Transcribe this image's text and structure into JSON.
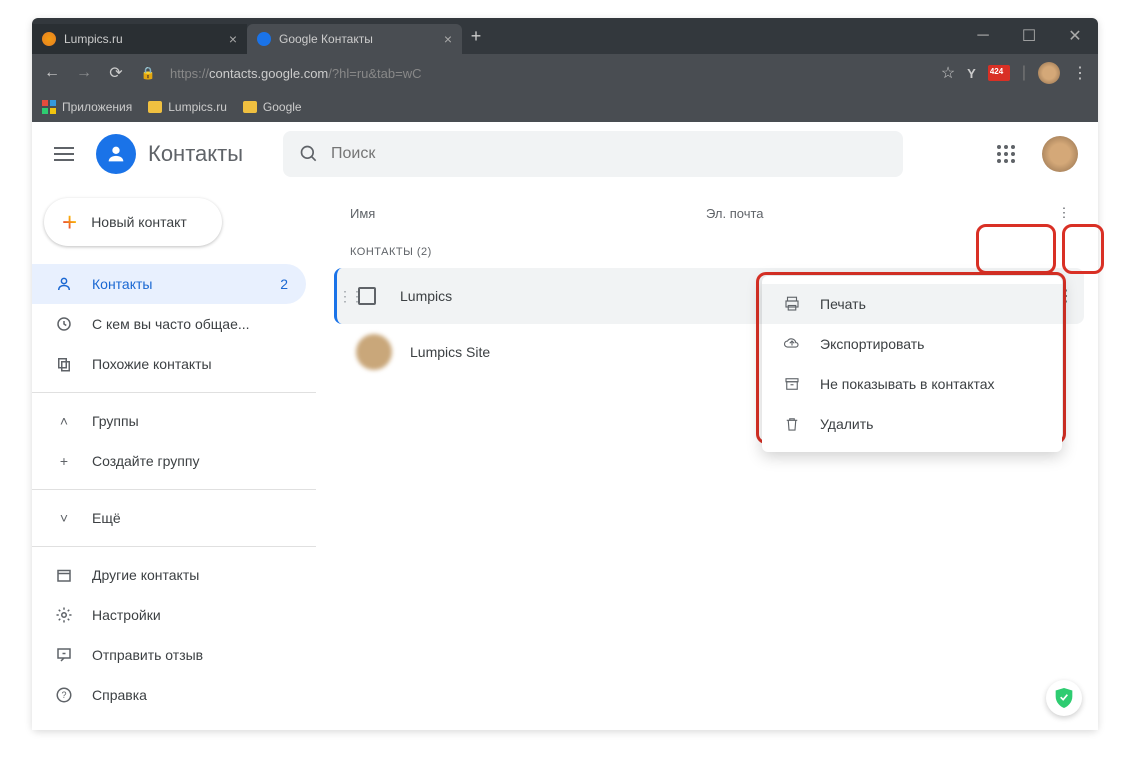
{
  "browser": {
    "tabs": [
      {
        "title": "Lumpics.ru",
        "active": false
      },
      {
        "title": "Google Контакты",
        "active": true
      }
    ],
    "url_prefix": "https://",
    "url_host": "contacts.google.com",
    "url_path": "/?hl=ru&tab=wC",
    "badge": "424",
    "bookmarks": {
      "apps": "Приложения",
      "b1": "Lumpics.ru",
      "b2": "Google"
    }
  },
  "header": {
    "title": "Контакты",
    "search_placeholder": "Поиск"
  },
  "sidebar": {
    "new_contact": "Новый контакт",
    "items": {
      "contacts": "Контакты",
      "contacts_count": "2",
      "frequent": "С кем вы часто общае...",
      "similar": "Похожие контакты",
      "groups": "Группы",
      "create_group": "Создайте группу",
      "more": "Ещё",
      "other": "Другие контакты",
      "settings": "Настройки",
      "feedback": "Отправить отзыв",
      "help": "Справка"
    }
  },
  "main": {
    "col_name": "Имя",
    "col_email": "Эл. почта",
    "section_label": "КОНТАКТЫ (2)",
    "rows": [
      {
        "name": "Lumpics"
      },
      {
        "name": "Lumpics Site"
      }
    ]
  },
  "ctx": {
    "print": "Печать",
    "export": "Экспортировать",
    "hide": "Не показывать в контактах",
    "delete": "Удалить"
  }
}
